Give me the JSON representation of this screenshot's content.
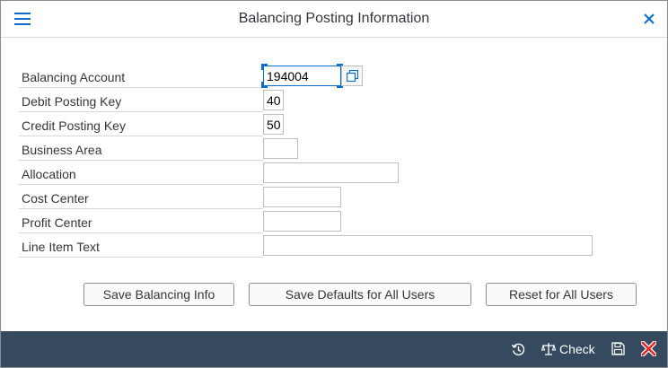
{
  "dialog": {
    "title": "Balancing Posting Information"
  },
  "form": {
    "balancing_account": {
      "label": "Balancing Account",
      "value": "194004"
    },
    "debit_posting_key": {
      "label": "Debit Posting Key",
      "value": "40"
    },
    "credit_posting_key": {
      "label": "Credit Posting Key",
      "value": "50"
    },
    "business_area": {
      "label": "Business Area",
      "value": ""
    },
    "allocation": {
      "label": "Allocation",
      "value": ""
    },
    "cost_center": {
      "label": "Cost Center",
      "value": ""
    },
    "profit_center": {
      "label": "Profit Center",
      "value": ""
    },
    "line_item_text": {
      "label": "Line Item Text",
      "value": ""
    }
  },
  "buttons": {
    "save_balancing_info": "Save Balancing Info",
    "save_defaults_all_users": "Save Defaults for All Users",
    "reset_all_users": "Reset for All Users"
  },
  "footer": {
    "check_label": "Check"
  },
  "icons": {
    "menu": "hamburger-icon",
    "close": "close-icon",
    "value_help": "value-help-icon",
    "history": "history-icon",
    "check": "balance-scale-icon",
    "save": "floppy-disk-icon",
    "cancel": "cancel-x-icon"
  },
  "colors": {
    "accent": "#0a6ed1",
    "footer_bg": "#354a5f",
    "cancel_red": "#e0292b"
  }
}
